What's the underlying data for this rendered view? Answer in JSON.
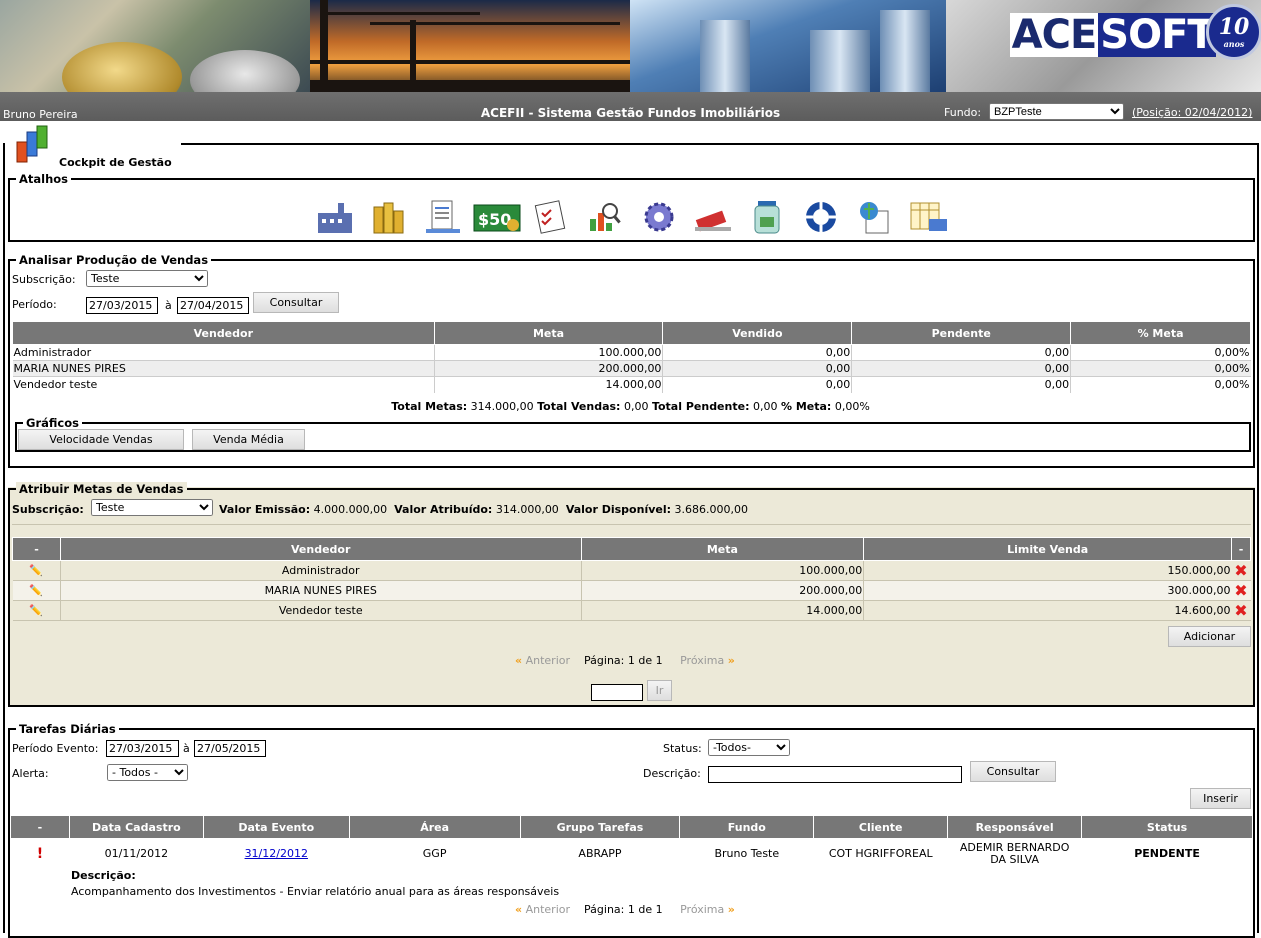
{
  "banner": {
    "logo_ace": "ACE",
    "logo_soft": "SOFT",
    "logo_ten": "10",
    "logo_anos": "anos"
  },
  "header": {
    "user": "Bruno Pereira",
    "title": "ACEFII - Sistema Gestão Fundos Imobiliários",
    "fund_label": "Fundo:",
    "fund_value": "BZPTeste",
    "position": "(Posição: 02/04/2012)"
  },
  "cockpit": {
    "title": "Cockpit de Gestão"
  },
  "shortcuts": {
    "legend": "Atalhos",
    "icons": [
      "factory-icon",
      "coins-icon",
      "document-icon",
      "money-icon",
      "checklist-icon",
      "chart-search-icon",
      "gear-icon",
      "eraser-icon",
      "jar-icon",
      "lifebuoy-icon",
      "globe-upload-icon",
      "table-export-icon"
    ]
  },
  "sales": {
    "legend": "Analisar Produção de Vendas",
    "subscription_label": "Subscrição:",
    "subscription_value": "Teste",
    "period_label": "Período:",
    "date_from": "27/03/2015",
    "to_label": "à",
    "date_to": "27/04/2015",
    "consult": "Consultar",
    "columns": [
      "Vendedor",
      "Meta",
      "Vendido",
      "Pendente",
      "% Meta"
    ],
    "rows": [
      [
        "Administrador",
        "100.000,00",
        "0,00",
        "0,00",
        "0,00%"
      ],
      [
        "MARIA NUNES PIRES",
        "200.000,00",
        "0,00",
        "0,00",
        "0,00%"
      ],
      [
        "Vendedor teste",
        "14.000,00",
        "0,00",
        "0,00",
        "0,00%"
      ]
    ],
    "totals": {
      "metas_label": "Total Metas:",
      "metas": "314.000,00",
      "vendas_label": "Total Vendas:",
      "vendas": "0,00",
      "pendente_label": "Total Pendente:",
      "pendente": "0,00",
      "meta_label": "% Meta:",
      "meta": "0,00%"
    },
    "charts_legend": "Gráficos",
    "chart_btn1": "Velocidade Vendas",
    "chart_btn2": "Venda Média"
  },
  "goals": {
    "legend": "Atribuir Metas de Vendas",
    "subscription_label": "Subscrição:",
    "subscription_value": "Teste",
    "emission_label": "Valor Emissão:",
    "emission": "4.000.000,00",
    "assigned_label": "Valor Atribuído:",
    "assigned": "314.000,00",
    "available_label": "Valor Disponível:",
    "available": "3.686.000,00",
    "columns": [
      "-",
      "Vendedor",
      "Meta",
      "Limite Venda",
      "-"
    ],
    "rows": [
      [
        "Administrador",
        "100.000,00",
        "150.000,00"
      ],
      [
        "MARIA NUNES PIRES",
        "200.000,00",
        "300.000,00"
      ],
      [
        "Vendedor teste",
        "14.000,00",
        "14.600,00"
      ]
    ],
    "add": "Adicionar",
    "prev": "Anterior",
    "page": "Página: 1 de 1",
    "next": "Próxima",
    "go": "Ir"
  },
  "tasks": {
    "legend": "Tarefas Diárias",
    "period_label": "Período Evento:",
    "date_from": "27/03/2015",
    "to_label": "à",
    "date_to": "27/05/2015",
    "status_label": "Status:",
    "status_value": "-Todos-",
    "alert_label": "Alerta:",
    "alert_value": "- Todos -",
    "desc_label": "Descrição:",
    "consult": "Consultar",
    "insert": "Inserir",
    "columns": [
      "-",
      "Data Cadastro",
      "Data Evento",
      "Área",
      "Grupo Tarefas",
      "Fundo",
      "Cliente",
      "Responsável",
      "Status"
    ],
    "row": {
      "alert": "!",
      "created": "01/11/2012",
      "event": "31/12/2012",
      "area": "GGP",
      "group": "ABRAPP",
      "fund": "Bruno Teste",
      "client": "COT HGRIFFOREAL",
      "responsible_1": "ADEMIR BERNARDO",
      "responsible_2": "DA SILVA",
      "status": "PENDENTE",
      "desc_label": "Descrição:",
      "desc": "Acompanhamento dos Investimentos - Enviar relatório anual para as áreas responsáveis"
    },
    "prev": "Anterior",
    "page": "Página: 1 de 1",
    "next": "Próxima"
  }
}
